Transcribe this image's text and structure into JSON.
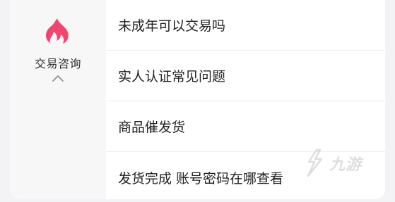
{
  "sidebar": {
    "icon": "flame-icon",
    "accent_color": "#f2456e",
    "category_label": "交易咨询",
    "collapse_icon": "chevron-up-icon"
  },
  "questions": [
    {
      "label": "未成年可以交易吗"
    },
    {
      "label": "实人认证常见问题"
    },
    {
      "label": "商品催发货"
    },
    {
      "label": "发货完成 账号密码在哪查看"
    }
  ],
  "watermark": {
    "text": "九游"
  }
}
